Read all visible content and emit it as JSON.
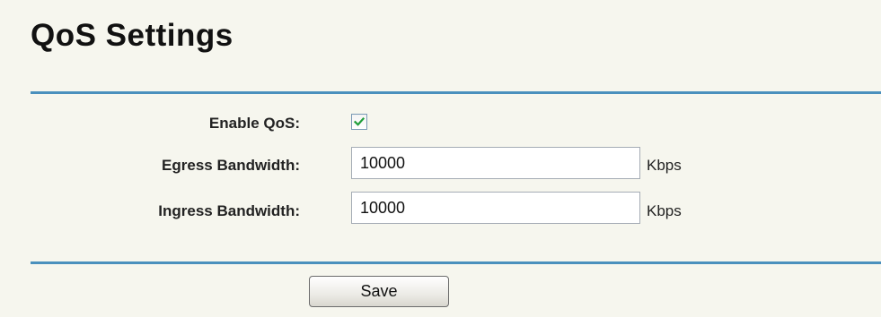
{
  "page": {
    "title": "QoS Settings"
  },
  "form": {
    "enable_qos": {
      "label": "Enable QoS:",
      "checked": true
    },
    "egress_bandwidth": {
      "label": "Egress Bandwidth:",
      "value": "10000",
      "unit": "Kbps"
    },
    "ingress_bandwidth": {
      "label": "Ingress Bandwidth:",
      "value": "10000",
      "unit": "Kbps"
    }
  },
  "actions": {
    "save_label": "Save"
  },
  "colors": {
    "panel_background": "#f6f6ee",
    "divider": "#4a90bd",
    "checkmark": "#1f9e3a"
  },
  "icons": {
    "checkbox": "checkmark-icon"
  }
}
